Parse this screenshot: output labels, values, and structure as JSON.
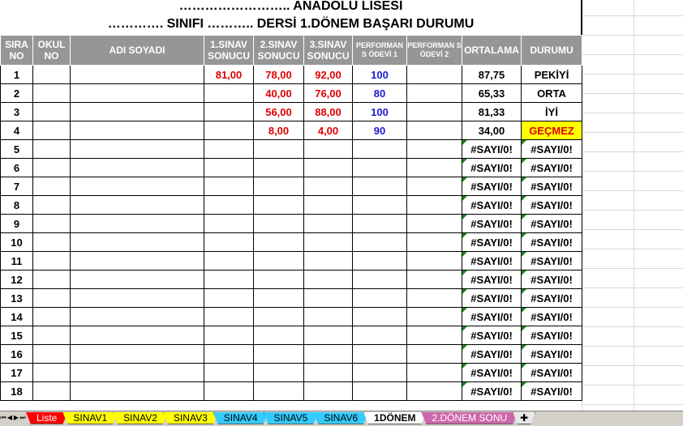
{
  "title_line1": "…………………….. ANADOLU LİSESİ",
  "title_line2": "…………. SINIFI ……….. DERSİ 1.DÖNEM BAŞARI DURUMU",
  "headers": {
    "sira": "SIRA NO",
    "okul": "OKUL NO",
    "adi": "ADI SOYADI",
    "s1": "1.SINAV SONUCU",
    "s2": "2.SINAV SONUCU",
    "s3": "3.SINAV SONUCU",
    "p1": "PERFORMAN S ÖDEVİ 1",
    "p2": "PERFORMAN S ÖDEVİ 2",
    "ort": "ORTALAMA",
    "dur": "DURUMU"
  },
  "rows": [
    {
      "no": "1",
      "s1": "81,00",
      "s2": "78,00",
      "s3": "92,00",
      "p1": "100",
      "ort": "87,75",
      "dur": "PEKİYİ"
    },
    {
      "no": "2",
      "s1": "",
      "s2": "40,00",
      "s3": "76,00",
      "p1": "80",
      "ort": "65,33",
      "dur": "ORTA"
    },
    {
      "no": "3",
      "s1": "",
      "s2": "56,00",
      "s3": "88,00",
      "p1": "100",
      "ort": "81,33",
      "dur": "İYİ"
    },
    {
      "no": "4",
      "s1": "",
      "s2": "8,00",
      "s3": "4,00",
      "p1": "90",
      "ort": "34,00",
      "dur": "GEÇMEZ"
    },
    {
      "no": "5",
      "ort": "#SAYI/0!",
      "dur": "#SAYI/0!"
    },
    {
      "no": "6",
      "ort": "#SAYI/0!",
      "dur": "#SAYI/0!"
    },
    {
      "no": "7",
      "ort": "#SAYI/0!",
      "dur": "#SAYI/0!"
    },
    {
      "no": "8",
      "ort": "#SAYI/0!",
      "dur": "#SAYI/0!"
    },
    {
      "no": "9",
      "ort": "#SAYI/0!",
      "dur": "#SAYI/0!"
    },
    {
      "no": "10",
      "ort": "#SAYI/0!",
      "dur": "#SAYI/0!"
    },
    {
      "no": "11",
      "ort": "#SAYI/0!",
      "dur": "#SAYI/0!"
    },
    {
      "no": "12",
      "ort": "#SAYI/0!",
      "dur": "#SAYI/0!"
    },
    {
      "no": "13",
      "ort": "#SAYI/0!",
      "dur": "#SAYI/0!"
    },
    {
      "no": "14",
      "ort": "#SAYI/0!",
      "dur": "#SAYI/0!"
    },
    {
      "no": "15",
      "ort": "#SAYI/0!",
      "dur": "#SAYI/0!"
    },
    {
      "no": "16",
      "ort": "#SAYI/0!",
      "dur": "#SAYI/0!"
    },
    {
      "no": "17",
      "ort": "#SAYI/0!",
      "dur": "#SAYI/0!"
    },
    {
      "no": "18",
      "ort": "#SAYI/0!",
      "dur": "#SAYI/0!"
    }
  ],
  "tabs": [
    {
      "label": "Liste",
      "bg": "#ff0000",
      "color": "#ffffff"
    },
    {
      "label": "SINAV1",
      "bg": "#ffff00",
      "color": "#000000"
    },
    {
      "label": "SINAV2",
      "bg": "#ffff00",
      "color": "#000000"
    },
    {
      "label": "SINAV3",
      "bg": "#ffff00",
      "color": "#000000"
    },
    {
      "label": "SINAV4",
      "bg": "#33ccff",
      "color": "#000000"
    },
    {
      "label": "SINAV5",
      "bg": "#33ccff",
      "color": "#000000"
    },
    {
      "label": "SINAV6",
      "bg": "#33ccff",
      "color": "#000000"
    },
    {
      "label": "1DÖNEM",
      "bg": "#ffffff",
      "color": "#000000",
      "active": true
    },
    {
      "label": "2.DÖNEM SONU",
      "bg": "#cc66aa",
      "color": "#ffffff"
    }
  ],
  "colors": {
    "header_bg": "#969696",
    "score_red": "#e00000",
    "perf_blue": "#1a1ad0",
    "fail_bg": "#ffff00"
  }
}
